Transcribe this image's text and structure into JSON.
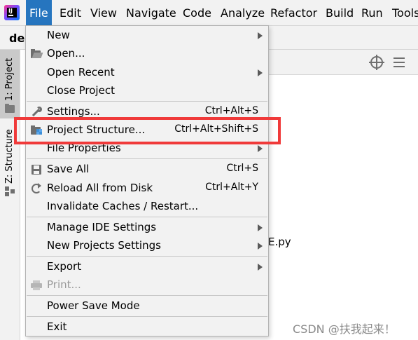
{
  "menubar": {
    "items": [
      {
        "label": "File",
        "active": true
      },
      {
        "label": "Edit"
      },
      {
        "label": "View"
      },
      {
        "label": "Navigate"
      },
      {
        "label": "Code"
      },
      {
        "label": "Analyze"
      },
      {
        "label": "Refactor"
      },
      {
        "label": "Build"
      },
      {
        "label": "Run"
      },
      {
        "label": "Tools"
      }
    ]
  },
  "editor": {
    "project_tab": "de",
    "partial_file": "E.py"
  },
  "tool_strip": {
    "project_label": "1: Project",
    "structure_label": "Z: Structure"
  },
  "file_menu": {
    "items": [
      {
        "label": "New",
        "submenu": true
      },
      {
        "label": "Open...",
        "icon": "open-folder-icon"
      },
      {
        "label": "Open Recent",
        "submenu": true
      },
      {
        "label": "Close Project"
      },
      {
        "label": "Settings...",
        "shortcut": "Ctrl+Alt+S",
        "icon": "wrench-icon"
      },
      {
        "label": "Project Structure...",
        "shortcut": "Ctrl+Alt+Shift+S",
        "icon": "project-structure-icon"
      },
      {
        "label": "File Properties",
        "submenu": true
      },
      {
        "label": "Save All",
        "shortcut": "Ctrl+S",
        "icon": "save-icon"
      },
      {
        "label": "Reload All from Disk",
        "shortcut": "Ctrl+Alt+Y",
        "icon": "reload-icon"
      },
      {
        "label": "Invalidate Caches / Restart..."
      },
      {
        "label": "Manage IDE Settings",
        "submenu": true
      },
      {
        "label": "New Projects Settings",
        "submenu": true
      },
      {
        "label": "Export",
        "submenu": true
      },
      {
        "label": "Print...",
        "disabled": true,
        "icon": "printer-icon"
      },
      {
        "label": "Power Save Mode"
      },
      {
        "label": "Exit"
      }
    ]
  },
  "watermark": "CSDN @扶我起来！",
  "colors": {
    "menu_active_bg": "#2675bf",
    "highlight_border": "#f03a3a",
    "menu_bg": "#f2f2f2"
  }
}
